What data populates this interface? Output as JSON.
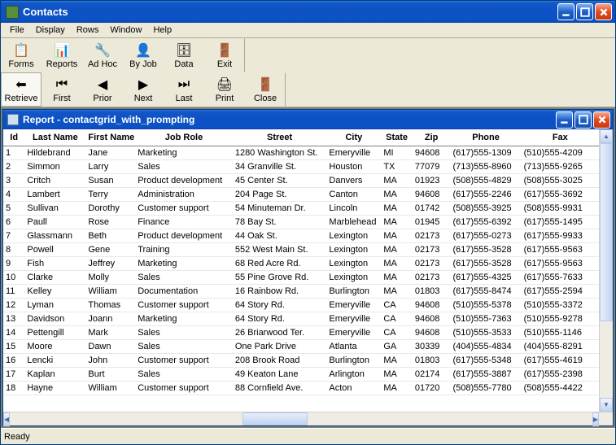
{
  "window": {
    "title": "Contacts"
  },
  "menu": {
    "items": [
      "File",
      "Display",
      "Rows",
      "Window",
      "Help"
    ]
  },
  "toolbar": {
    "row1": [
      {
        "label": "Forms",
        "icon": "📋"
      },
      {
        "label": "Reports",
        "icon": "📊"
      },
      {
        "label": "Ad Hoc",
        "icon": "🔧"
      },
      {
        "label": "By Job",
        "icon": "👤"
      },
      {
        "label": "Data",
        "icon": "🗄"
      },
      {
        "label": "Exit",
        "icon": "🚪"
      }
    ],
    "row2": [
      {
        "label": "Retrieve",
        "icon": "⬅"
      },
      {
        "label": "First",
        "icon": "⏮"
      },
      {
        "label": "Prior",
        "icon": "◀"
      },
      {
        "label": "Next",
        "icon": "▶"
      },
      {
        "label": "Last",
        "icon": "⏭"
      },
      {
        "label": "Print",
        "icon": "🖨"
      },
      {
        "label": "Close",
        "icon": "🚪"
      }
    ]
  },
  "report": {
    "title": "Report - contactgrid_with_prompting",
    "columns": [
      "Id",
      "Last Name",
      "First Name",
      "Job Role",
      "Street",
      "City",
      "State",
      "Zip",
      "Phone",
      "Fax"
    ],
    "rows": [
      [
        "1",
        "Hildebrand",
        "Jane",
        "Marketing",
        "1280 Washington St.",
        "Emeryville",
        "MI",
        "94608",
        "(617)555-1309",
        "(510)555-4209"
      ],
      [
        "2",
        "Simmon",
        "Larry",
        "Sales",
        "34 Granville St.",
        "Houston",
        "TX",
        "77079",
        "(713)555-8960",
        "(713)555-9265"
      ],
      [
        "3",
        "Critch",
        "Susan",
        "Product development",
        "45 Center St.",
        "Danvers",
        "MA",
        "01923",
        "(508)555-4829",
        "(508)555-3025"
      ],
      [
        "4",
        "Lambert",
        "Terry",
        "Administration",
        "204 Page St.",
        "Canton",
        "MA",
        "94608",
        "(617)555-2246",
        "(617)555-3692"
      ],
      [
        "5",
        "Sullivan",
        "Dorothy",
        "Customer support",
        "54 Minuteman Dr.",
        "Lincoln",
        "MA",
        "01742",
        "(508)555-3925",
        "(508)555-9931"
      ],
      [
        "6",
        "Paull",
        "Rose",
        "Finance",
        "78 Bay St.",
        "Marblehead",
        "MA",
        "01945",
        "(617)555-6392",
        "(617)555-1495"
      ],
      [
        "7",
        "Glassmann",
        "Beth",
        "Product development",
        "44 Oak St.",
        "Lexington",
        "MA",
        "02173",
        "(617)555-0273",
        "(617)555-9933"
      ],
      [
        "8",
        "Powell",
        "Gene",
        "Training",
        "552 West Main St.",
        "Lexington",
        "MA",
        "02173",
        "(617)555-3528",
        "(617)555-9563"
      ],
      [
        "9",
        "Fish",
        "Jeffrey",
        "Marketing",
        "68 Red Acre Rd.",
        "Lexington",
        "MA",
        "02173",
        "(617)555-3528",
        "(617)555-9563"
      ],
      [
        "10",
        "Clarke",
        "Molly",
        "Sales",
        "55 Pine Grove Rd.",
        "Lexington",
        "MA",
        "02173",
        "(617)555-4325",
        "(617)555-7633"
      ],
      [
        "11",
        "Kelley",
        "William",
        "Documentation",
        "16 Rainbow Rd.",
        "Burlington",
        "MA",
        "01803",
        "(617)555-8474",
        "(617)555-2594"
      ],
      [
        "12",
        "Lyman",
        "Thomas",
        "Customer support",
        "64 Story Rd.",
        "Emeryville",
        "CA",
        "94608",
        "(510)555-5378",
        "(510)555-3372"
      ],
      [
        "13",
        "Davidson",
        "Joann",
        "Marketing",
        "64 Story Rd.",
        "Emeryville",
        "CA",
        "94608",
        "(510)555-7363",
        "(510)555-9278"
      ],
      [
        "14",
        "Pettengill",
        "Mark",
        "Sales",
        "26 Briarwood Ter.",
        "Emeryville",
        "CA",
        "94608",
        "(510)555-3533",
        "(510)555-1146"
      ],
      [
        "15",
        "Moore",
        "Dawn",
        "Sales",
        "One Park Drive",
        "Atlanta",
        "GA",
        "30339",
        "(404)555-4834",
        "(404)555-8291"
      ],
      [
        "16",
        "Lencki",
        "John",
        "Customer support",
        "208 Brook Road",
        "Burlington",
        "MA",
        "01803",
        "(617)555-5348",
        "(617)555-4619"
      ],
      [
        "17",
        "Kaplan",
        "Burt",
        "Sales",
        "49 Keaton Lane",
        "Arlington",
        "MA",
        "02174",
        "(617)555-3887",
        "(617)555-2398"
      ],
      [
        "18",
        "Hayne",
        "William",
        "Customer support",
        "88 Cornfield Ave.",
        "Acton",
        "MA",
        "01720",
        "(508)555-7780",
        "(508)555-4422"
      ]
    ]
  },
  "status": {
    "text": "Ready"
  }
}
